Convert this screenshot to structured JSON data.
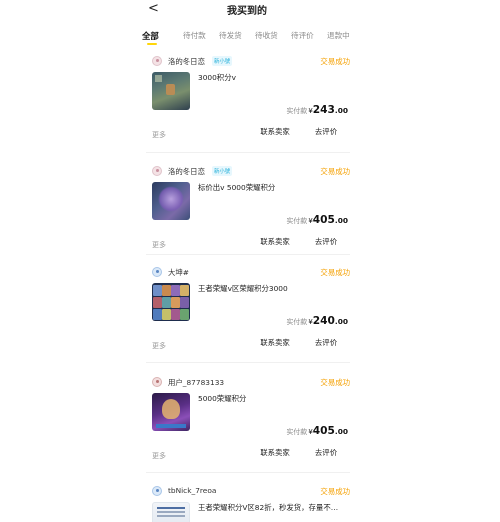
{
  "header": {
    "back_glyph": "<",
    "title": "我买到的"
  },
  "tabs": [
    {
      "label": "全部",
      "active": true
    },
    {
      "label": "待付款"
    },
    {
      "label": "待发货"
    },
    {
      "label": "待收货"
    },
    {
      "label": "待评价"
    },
    {
      "label": "退款中"
    }
  ],
  "colors": {
    "accent": "#ffd60a",
    "status": "#f5a000",
    "badge": "#26b0d9"
  },
  "orders": [
    {
      "seller": "洛的冬日恋",
      "badge": "新小號",
      "status": "交易成功",
      "title": "3000积分v",
      "price_label": "实付款",
      "currency": "¥",
      "price_int": "243",
      "price_dec": ".00",
      "more": "更多",
      "contact": "联系卖家",
      "review": "去评价",
      "avatar_icon": "user-avatar-icon"
    },
    {
      "seller": "洛的冬日恋",
      "badge": "新小號",
      "status": "交易成功",
      "title": "标价出v 5000荣耀积分",
      "price_label": "实付款",
      "currency": "¥",
      "price_int": "405",
      "price_dec": ".00",
      "more": "更多",
      "contact": "联系卖家",
      "review": "去评价",
      "avatar_icon": "user-avatar-icon"
    },
    {
      "seller": "大坤#",
      "status": "交易成功",
      "title": "王者荣耀v区荣耀积分3000",
      "price_label": "实付款",
      "currency": "¥",
      "price_int": "240",
      "price_dec": ".00",
      "more": "更多",
      "contact": "联系卖家",
      "review": "去评价",
      "avatar_icon": "user-avatar-icon"
    },
    {
      "seller": "用户_87783133",
      "status": "交易成功",
      "title": "5000荣耀积分",
      "price_label": "实付款",
      "currency": "¥",
      "price_int": "405",
      "price_dec": ".00",
      "more": "更多",
      "contact": "联系卖家",
      "review": "去评价",
      "avatar_icon": "user-avatar-icon"
    },
    {
      "seller": "tbNick_7reoa",
      "status": "交易成功",
      "title": "王者荣耀积分Ⅴ区82折，秒发货，存量不…",
      "avatar_icon": "user-avatar-icon"
    }
  ]
}
